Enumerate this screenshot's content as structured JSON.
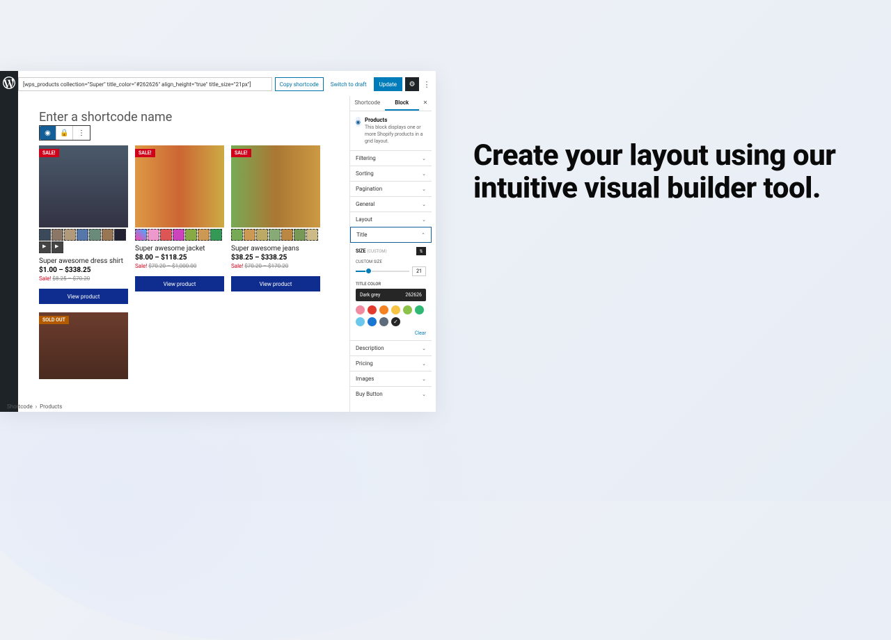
{
  "heading": "Create your layout using our intuitive visual builder tool.",
  "topbar": {
    "shortcode": "[wps_products collection=\"Super\" title_color=\"#262626\" align_height=\"true\" title_size=\"21px\"]",
    "copy": "Copy shortcode",
    "draft": "Switch to draft",
    "update": "Update"
  },
  "editor": {
    "shortcode_name_placeholder": "Enter a shortcode name",
    "breadcrumb_root": "Shortcode",
    "breadcrumb_leaf": "Products"
  },
  "products": [
    {
      "badge": "SALE!",
      "title": "Super awesome dress shirt",
      "price": "$1.00 – $338.25",
      "sale": "Sale!",
      "old": "$8.25 – $70.20",
      "btn": "View product",
      "hero": "hbg1",
      "thumbs": [
        "t1",
        "t2",
        "t3",
        "t4",
        "t5",
        "t6",
        "t7",
        "t8",
        "t8"
      ],
      "thumbs_rows": 2
    },
    {
      "badge": "SALE!",
      "title": "Super awesome jacket",
      "price": "$8.00 – $118.25",
      "sale": "Sale!",
      "old": "$70.20 – $1,000.00",
      "btn": "View product",
      "hero": "hbg2",
      "thumbs": [
        "ta",
        "tb",
        "tc",
        "td",
        "te",
        "tf",
        "tg"
      ],
      "thumbs_rows": 1
    },
    {
      "badge": "SALE!",
      "title": "Super awesome jeans",
      "price": "$38.25 – $338.25",
      "sale": "Sale!",
      "old": "$70.20 – $170.20",
      "btn": "View product",
      "hero": "hbg3",
      "thumbs": [
        "th",
        "ti",
        "tj",
        "tk",
        "tl",
        "tm",
        "tn"
      ],
      "thumbs_rows": 1
    }
  ],
  "product2": {
    "badge": "SOLD OUT",
    "hero": "hbg4"
  },
  "sidebar": {
    "tab1": "Shortcode",
    "tab2": "Block",
    "block_name": "Products",
    "block_desc": "This block displays one or more Shopify products in a grid layout.",
    "panels_top": [
      "Filtering",
      "Sorting",
      "Pagination",
      "General",
      "Layout"
    ],
    "title_panel": "Title",
    "size_label": "SIZE",
    "size_mode": "(CUSTOM)",
    "custom_size_label": "CUSTOM SIZE",
    "size_value": "21",
    "title_color_label": "TITLE COLOR",
    "color_name": "Dark grey",
    "color_hex": "262626",
    "swatches": [
      "#f28ba0",
      "#e23b2e",
      "#f58220",
      "#f6c344",
      "#8bc34a",
      "#2eb872",
      "#6cc7ec",
      "#1976d2",
      "#5e6b7a",
      "#262626"
    ],
    "swatch_checked_index": 9,
    "clear": "Clear",
    "panels_bottom": [
      "Description",
      "Pricing",
      "Images",
      "Buy Button"
    ]
  }
}
